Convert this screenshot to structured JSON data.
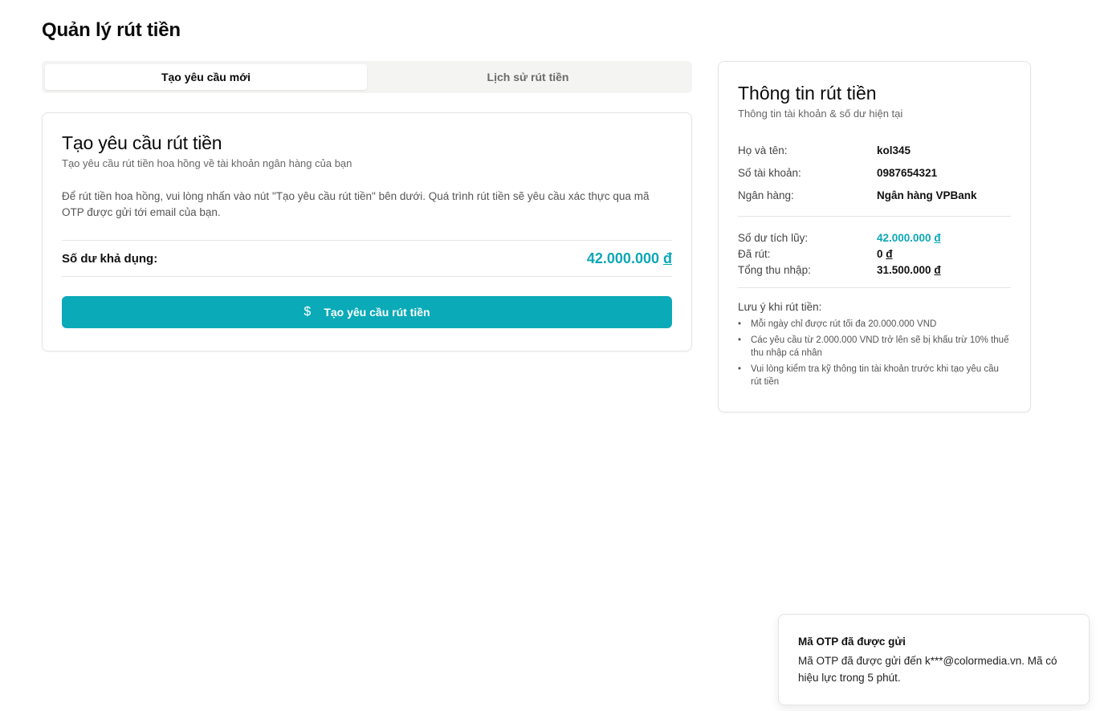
{
  "page": {
    "title": "Quản lý rút tiền"
  },
  "tabs": [
    {
      "label": "Tạo yêu cầu mới",
      "active": true
    },
    {
      "label": "Lịch sử rút tiền",
      "active": false
    }
  ],
  "request_card": {
    "title": "Tạo yêu cầu rút tiền",
    "subtitle": "Tạo yêu cầu rút tiền hoa hồng về tài khoản ngân hàng của bạn",
    "description": "Để rút tiền hoa hồng, vui lòng nhấn vào nút \"Tạo yêu cầu rút tiền\" bên dưới. Quá trình rút tiền sẽ yêu cầu xác thực qua mã OTP được gửi tới email của bạn.",
    "balance_label": "Số dư khả dụng:",
    "balance_amount": "42.000.000",
    "currency": "đ",
    "button_label": "Tạo yêu cầu rút tiền",
    "button_icon": "dollar-icon"
  },
  "info_card": {
    "title": "Thông tin rút tiền",
    "subtitle": "Thông tin tài khoản & số dư hiện tại",
    "account": [
      {
        "label": "Họ và tên:",
        "value": "kol345"
      },
      {
        "label": "Số tài khoản:",
        "value": "0987654321"
      },
      {
        "label": "Ngân hàng:",
        "value": "Ngân hàng VPBank"
      }
    ],
    "stats": [
      {
        "label": "Số dư tích lũy:",
        "amount": "42.000.000",
        "currency": "đ"
      },
      {
        "label": "Đã rút:",
        "amount": "0",
        "currency": "đ"
      },
      {
        "label": "Tổng thu nhập:",
        "amount": "31.500.000",
        "currency": "đ"
      }
    ],
    "notes_title": "Lưu ý khi rút tiền:",
    "notes": [
      "Mỗi ngày chỉ được rút tối đa 20.000.000 VND",
      "Các yêu cầu từ 2.000.000 VND trở lên sẽ bị khấu trừ 10% thuế thu nhập cá nhân",
      "Vui lòng kiểm tra kỹ thông tin tài khoản trước khi tạo yêu cầu rút tiền"
    ]
  },
  "toast": {
    "title": "Mã OTP đã được gửi",
    "body": "Mã OTP đã được gửi đến k***@colormedia.vn. Mã có hiệu lực trong 5 phút."
  },
  "colors": {
    "accent": "#0aaab8",
    "accent_text": "#0ba7b7"
  }
}
